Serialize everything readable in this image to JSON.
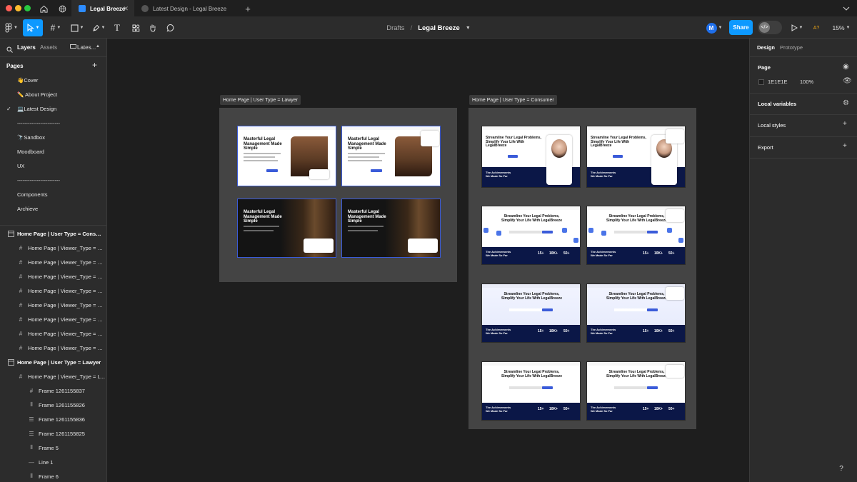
{
  "window": {
    "tabs": [
      {
        "label": "Legal Breeze"
      },
      {
        "label": "Latest Design - Legal Breeze"
      }
    ]
  },
  "toolbar": {
    "breadcrumb_parent": "Drafts",
    "separator": "/",
    "file_name": "Legal Breeze",
    "share_label": "Share",
    "avatar_initial": "M",
    "font_indicator": "A?",
    "zoom": "15%"
  },
  "left_panel": {
    "tab_layers": "Layers",
    "tab_assets": "Assets",
    "tab_page": "Lates...",
    "pages_heading": "Pages",
    "pages": [
      {
        "label": "👋Cover"
      },
      {
        "label": "✏️ About Project"
      },
      {
        "label": "💻Latest Design"
      },
      {
        "label": "------------------------"
      },
      {
        "label": "🔭Sandbox"
      },
      {
        "label": "Moodboard"
      },
      {
        "label": "UX"
      },
      {
        "label": "------------------------"
      },
      {
        "label": "Components"
      },
      {
        "label": "Archieve"
      }
    ],
    "layers": [
      {
        "label": "Home Page | User Type = Consum..."
      },
      {
        "label": "Home Page | Viewer_Type = C..."
      },
      {
        "label": "Home Page | Viewer_Type = C..."
      },
      {
        "label": "Home Page | Viewer_Type = C..."
      },
      {
        "label": "Home Page | Viewer_Type = C..."
      },
      {
        "label": "Home Page | Viewer_Type = C..."
      },
      {
        "label": "Home Page | Viewer_Type = C..."
      },
      {
        "label": "Home Page | Viewer_Type = C..."
      },
      {
        "label": "Home Page | Viewer_Type = C..."
      },
      {
        "label": "Home Page | User Type = Lawyer"
      },
      {
        "label": "Home Page | Viewer_Type = L..."
      },
      {
        "label": "Frame 1261155837"
      },
      {
        "label": "Frame 1261155826"
      },
      {
        "label": "Frame 1261155836"
      },
      {
        "label": "Frame 1261155825"
      },
      {
        "label": "Frame 5"
      },
      {
        "label": "Line 1"
      },
      {
        "label": "Frame 6"
      }
    ]
  },
  "right_panel": {
    "tab_design": "Design",
    "tab_prototype": "Prototype",
    "page_heading": "Page",
    "page_color": "1E1E1E",
    "page_opacity": "100%",
    "local_variables": "Local variables",
    "local_styles": "Local styles",
    "export": "Export"
  },
  "canvas": {
    "lawyer_frame_label": "Home Page | User Type = Lawyer",
    "consumer_frame_label": "Home Page | User Type = Consumer",
    "lawyer_thumbs": [
      {
        "headline": "Masterful Legal Management Made Simple"
      },
      {
        "headline": "Masterful Legal Management Made Simple"
      },
      {
        "headline": "Masterful Legal Management Made Simple"
      },
      {
        "headline": "Masterful Legal Management Made Simple"
      }
    ],
    "consumer_thumbs_top": {
      "headline": "Streamline Your Legal Problems, Simplify Your Life With LegalBreeze"
    },
    "consumer_thumbs_center": {
      "headline": "Streamline Your Legal Problems, Simplify Your Life With LegalBreeze"
    },
    "achievements": "The Achievements We Made So Far",
    "stats": [
      "15+",
      "10K+",
      "50+"
    ]
  },
  "help_label": "?",
  "colors": {
    "accent": "#0d99ff",
    "canvas": "#1e1e1e",
    "frame": "#444444",
    "navy": "#0b1747"
  }
}
